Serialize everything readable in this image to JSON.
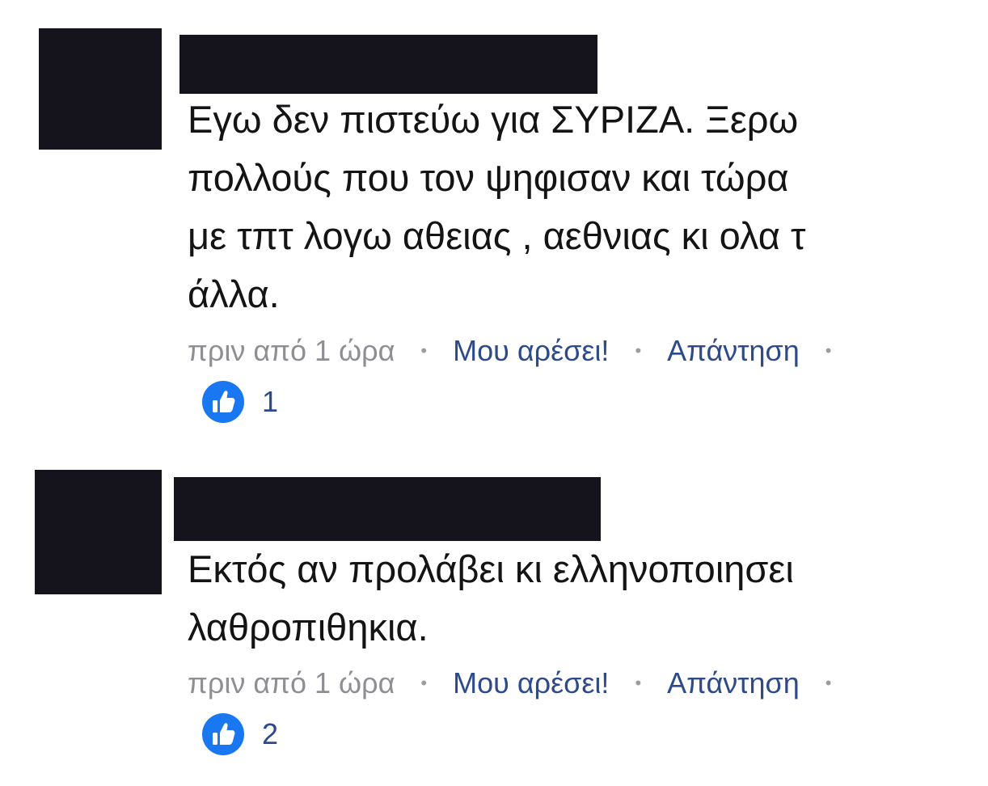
{
  "colors": {
    "redaction": "#15141c",
    "body_text": "#141414",
    "timestamp": "#8d8f94",
    "link": "#2d4a8a",
    "like_blue": "#1977f2"
  },
  "comments": [
    {
      "text": "Εγω δεν πιστεύω για ΣΥΡΙΖΑ.  Ξερω\nπολλούς που τον ψηφισαν και τώρα\nμε τπτ λογω αθειας , αεθνιας κι ολα τ\nάλλα.",
      "time": "πριν από 1 ώρα",
      "like_label": "Μου αρέσει!",
      "reply_label": "Απάντηση",
      "like_count": "1",
      "reaction_icon": "thumbs-up-icon"
    },
    {
      "text": "Εκτός αν προλάβει κι ελληνοποιησει\nλαθροπιθηκια.",
      "time": "πριν από 1 ώρα",
      "like_label": "Μου αρέσει!",
      "reply_label": "Απάντηση",
      "like_count": "2",
      "reaction_icon": "thumbs-up-icon"
    }
  ]
}
